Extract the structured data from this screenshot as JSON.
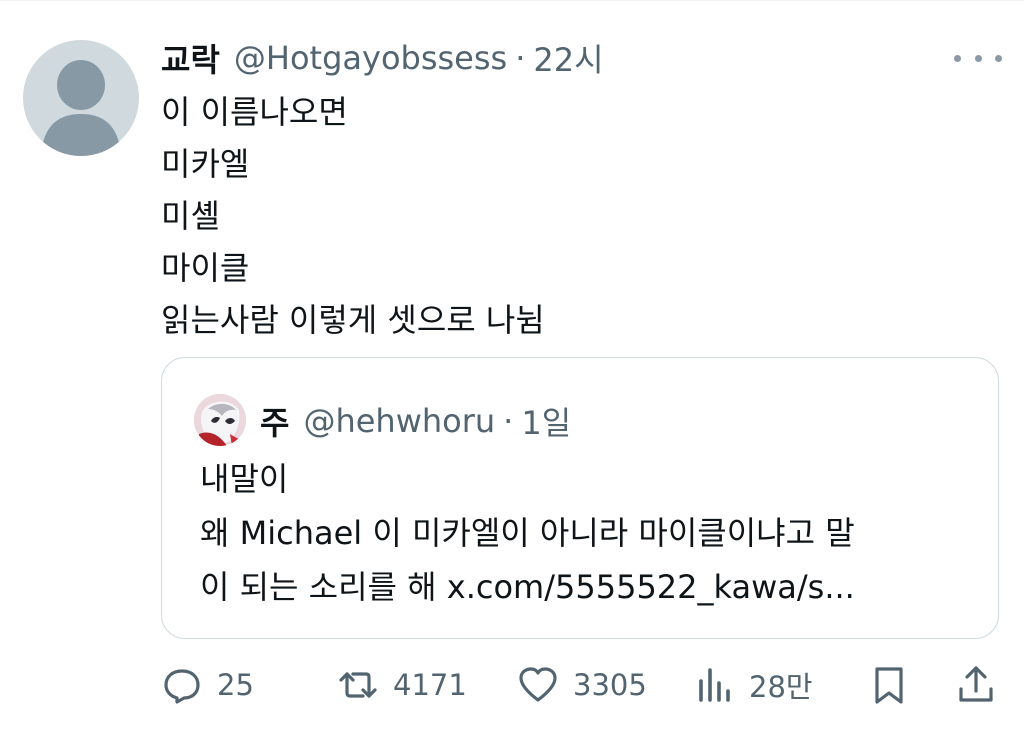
{
  "tweet": {
    "author_name": "교락",
    "handle": "@Hotgayobssess",
    "separator": "·",
    "time": "22시",
    "lines": [
      "이 이름나오면",
      "미카엘",
      "미셸",
      "마이클",
      "읽는사람 이렇게 셋으로 나뉨"
    ]
  },
  "quote": {
    "author_name": "주",
    "handle": "@hehwhoru",
    "separator": "·",
    "time": "1일",
    "lines": [
      "내말이",
      "왜 Michael 이 미카엘이 아니라 마이클이냐고 말",
      "이 되는 소리를 해 x.com/5555522_kawa/s..."
    ]
  },
  "actions": {
    "replies": "25",
    "retweets": "4171",
    "likes": "3305",
    "views": "28만"
  },
  "icons": {
    "more": "more-dots-icon",
    "reply": "reply-icon",
    "retweet": "retweet-icon",
    "like": "heart-icon",
    "views": "views-chart-icon",
    "bookmark": "bookmark-icon",
    "share": "share-icon"
  },
  "colors": {
    "text": "#0f1419",
    "secondary": "#536471",
    "border": "#cfd9de",
    "avatar_bg": "#cfd9de"
  }
}
